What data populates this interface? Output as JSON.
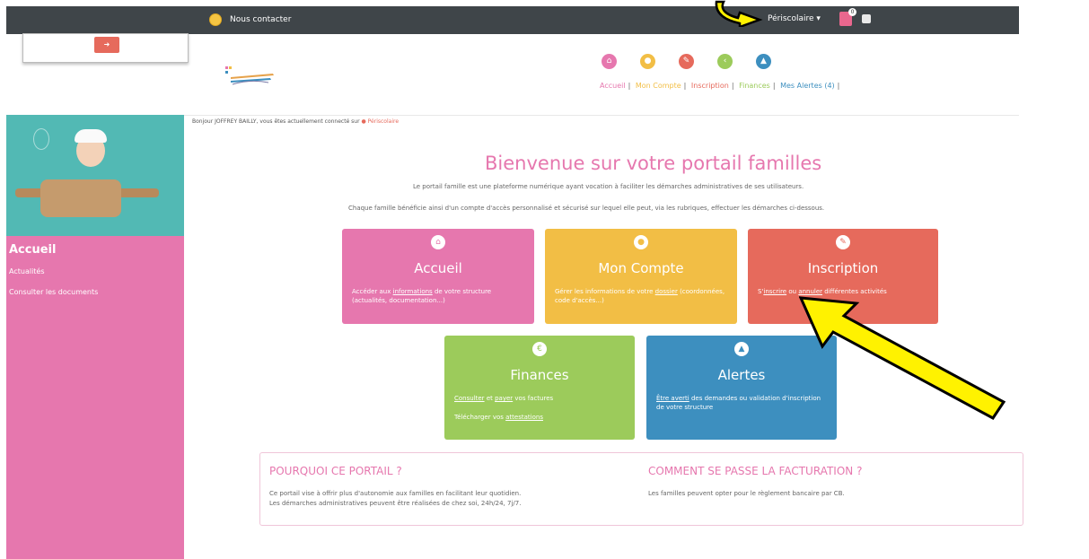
{
  "topbar": {
    "contact_label": "Nous contacter",
    "context_label": "Périscolaire",
    "notif_count": "0"
  },
  "nav": {
    "items": [
      {
        "label": "Accueil",
        "color": "#e677ae",
        "icon": "home-icon"
      },
      {
        "label": "Mon Compte",
        "color": "#f2be45",
        "icon": "user-icon"
      },
      {
        "label": "Inscription",
        "color": "#e66a5c",
        "icon": "pencil-icon"
      },
      {
        "label": "Finances",
        "color": "#9ccb5b",
        "icon": "euro-icon"
      },
      {
        "label": "Mes Alertes (4)",
        "color": "#3d8fbf",
        "icon": "warning-icon"
      }
    ]
  },
  "sidebar": {
    "title": "Accueil",
    "items": [
      "Actualités",
      "Consulter les documents"
    ]
  },
  "greeting": {
    "text": "Bonjour JOFFREY BAILLY, vous êtes actuellement connecté sur",
    "context": "Périscolaire"
  },
  "main": {
    "title": "Bienvenue sur votre portail familles",
    "intro1": "Le portail famille est une plateforme numérique ayant vocation à faciliter les démarches administratives de ses utilisateurs.",
    "intro2": "Chaque famille bénéficie ainsi d'un compte d'accès personnalisé et sécurisé sur lequel elle peut, via les rubriques, effectuer les démarches ci-dessous."
  },
  "tiles": {
    "accueil": {
      "title": "Accueil",
      "d_a": "Accéder aux",
      "d_link": "informations",
      "d_b": "de votre structure (actualités, documentation...)"
    },
    "compte": {
      "title": "Mon Compte",
      "d_a": "Gérer les informations de votre",
      "d_link": "dossier",
      "d_b": "(coordonnées, code d'accès...)"
    },
    "inscription": {
      "title": "Inscription",
      "d_a": "S'",
      "d_link": "inscrire",
      "d_mid": "ou",
      "d_link2": "annuler",
      "d_b": "différentes activités"
    },
    "finances": {
      "title": "Finances",
      "d_link": "Consulter",
      "d_mid": "et",
      "d_link2": "payer",
      "d_b": "vos factures",
      "d2_a": "Télécharger vos",
      "d2_link": "attestations"
    },
    "alertes": {
      "title": "Alertes",
      "d_link": "Être averti",
      "d_b": "des demandes ou validation d'inscription de votre structure"
    }
  },
  "info": {
    "h1": "POURQUOI CE PORTAIL ?",
    "t1a": "Ce portail vise à offrir plus d'autonomie aux familles en facilitant leur quotidien.",
    "t1b": "Les démarches administratives peuvent être réalisées de chez soi, 24h/24, 7j/7.",
    "h2": "COMMENT SE PASSE LA FACTURATION ?",
    "t2": "Les familles peuvent opter pour le règlement bancaire par CB."
  }
}
